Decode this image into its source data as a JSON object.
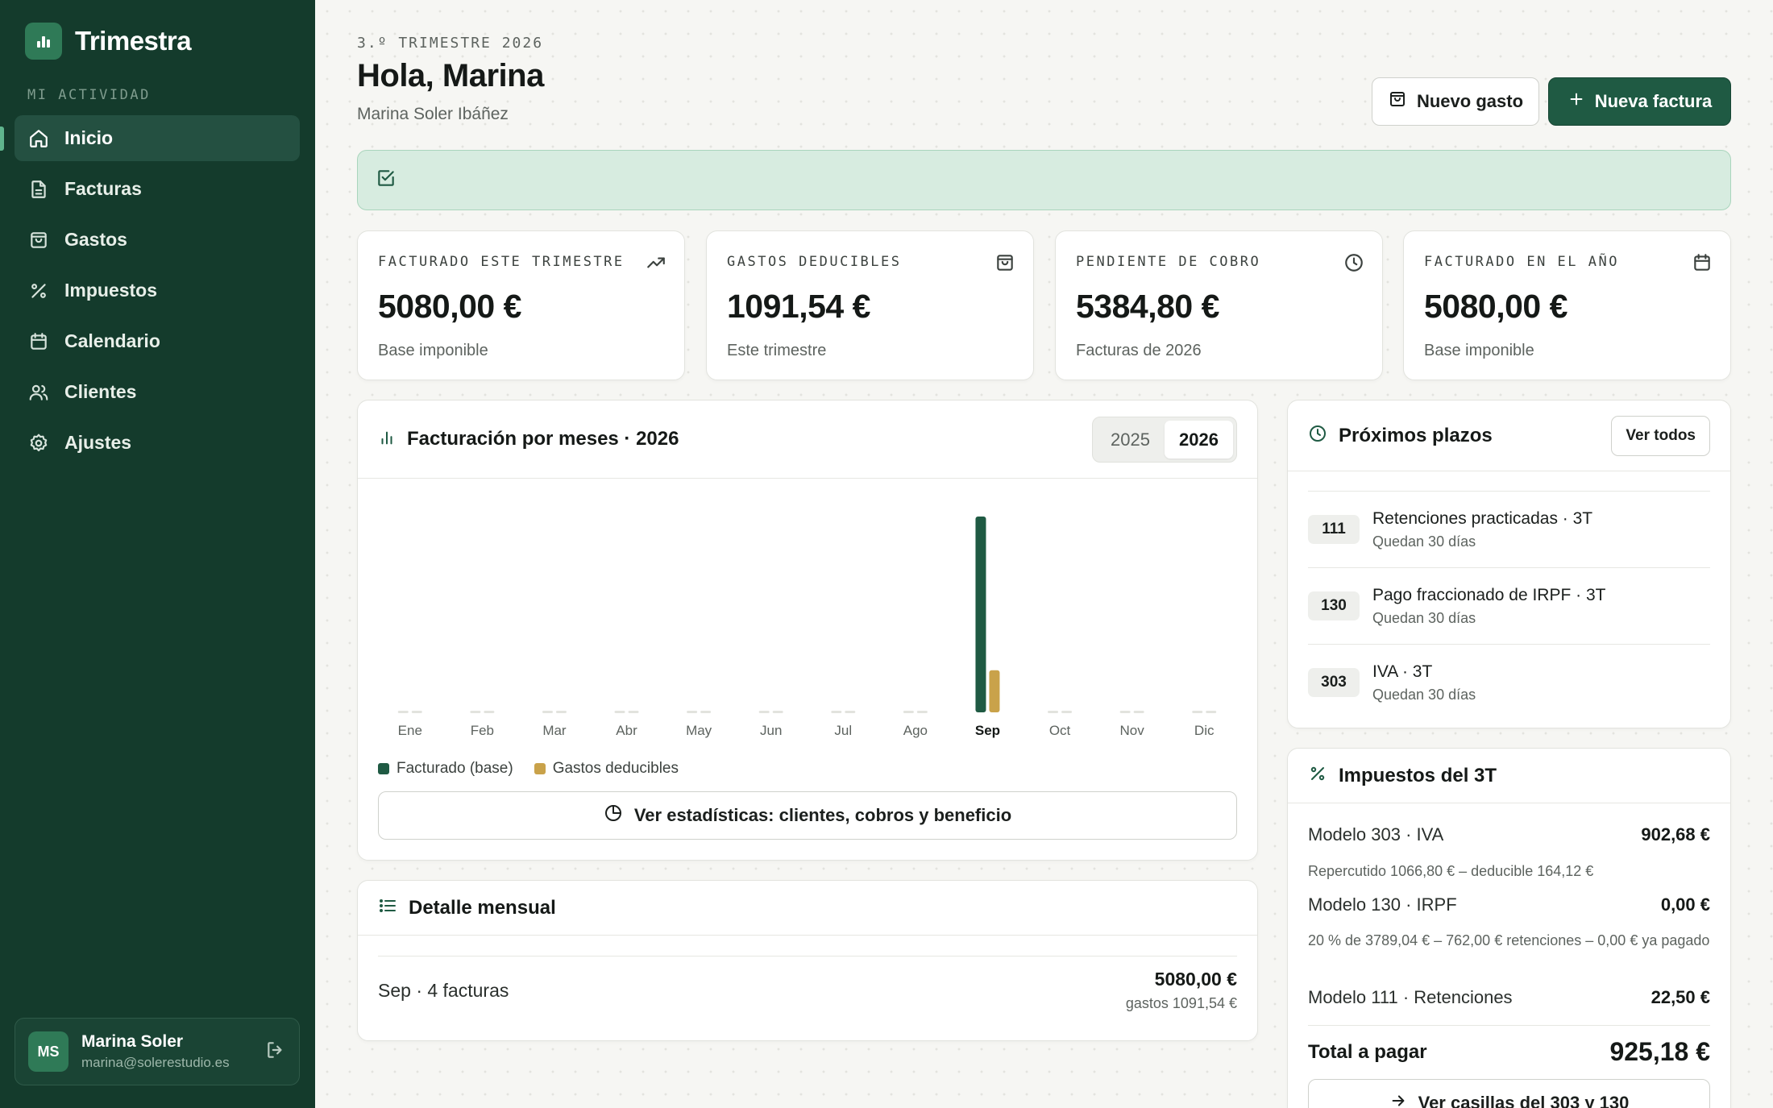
{
  "app": {
    "name": "Trimestra"
  },
  "sidebar": {
    "section_label": "MI ACTIVIDAD",
    "items": [
      {
        "label": "Inicio",
        "icon": "home-icon",
        "active": true
      },
      {
        "label": "Facturas",
        "icon": "document-icon"
      },
      {
        "label": "Gastos",
        "icon": "shopping-bag-icon"
      },
      {
        "label": "Impuestos",
        "icon": "percent-icon"
      },
      {
        "label": "Calendario",
        "icon": "calendar-icon"
      },
      {
        "label": "Clientes",
        "icon": "users-icon"
      },
      {
        "label": "Ajustes",
        "icon": "gear-icon"
      }
    ],
    "user": {
      "initials": "MS",
      "name": "Marina Soler",
      "email": "marina@solerestudio.es"
    }
  },
  "header": {
    "eyebrow": "3.º TRIMESTRE 2026",
    "greeting": "Hola, Marina",
    "fullname": "Marina Soler Ibáñez",
    "new_expense": "Nuevo gasto",
    "new_invoice": "Nueva factura"
  },
  "stats": [
    {
      "label": "FACTURADO ESTE TRIMESTRE",
      "value": "5080,00 €",
      "sub": "Base imponible",
      "icon": "trending-up-icon"
    },
    {
      "label": "GASTOS DEDUCIBLES",
      "value": "1091,54 €",
      "sub": "Este trimestre",
      "icon": "shopping-bag-icon"
    },
    {
      "label": "PENDIENTE DE COBRO",
      "value": "5384,80 €",
      "sub": "Facturas de 2026",
      "icon": "clock-icon"
    },
    {
      "label": "FACTURADO EN EL AÑO",
      "value": "5080,00 €",
      "sub": "Base imponible",
      "icon": "calendar-icon"
    }
  ],
  "chart_card": {
    "title": "Facturación por meses · 2026",
    "years": [
      "2025",
      "2026"
    ],
    "selected_year": "2026",
    "stats_button": "Ver estadísticas: clientes, cobros y beneficio"
  },
  "chart_data": {
    "type": "bar",
    "categories": [
      "Ene",
      "Feb",
      "Mar",
      "Abr",
      "May",
      "Jun",
      "Jul",
      "Ago",
      "Sep",
      "Oct",
      "Nov",
      "Dic"
    ],
    "highlight": "Sep",
    "series": [
      {
        "name": "Facturado (base)",
        "color": "#1f5a43",
        "values": [
          0,
          0,
          0,
          0,
          0,
          0,
          0,
          0,
          5080.0,
          0,
          0,
          0
        ]
      },
      {
        "name": "Gastos deducibles",
        "color": "#c9a24a",
        "values": [
          0,
          0,
          0,
          0,
          0,
          0,
          0,
          0,
          1091.54,
          0,
          0,
          0
        ]
      }
    ],
    "grid": false,
    "legend": "bottom-left"
  },
  "detail": {
    "title": "Detalle mensual",
    "row": {
      "label": "Sep · 4 facturas",
      "amount": "5080,00 €",
      "gastos": "gastos 1091,54 €"
    }
  },
  "plazos": {
    "title": "Próximos plazos",
    "view_all": "Ver todos",
    "items": [
      {
        "code": "111",
        "title": "Retenciones practicadas · 3T",
        "sub": "Quedan 30 días"
      },
      {
        "code": "130",
        "title": "Pago fraccionado de IRPF · 3T",
        "sub": "Quedan 30 días"
      },
      {
        "code": "303",
        "title": "IVA · 3T",
        "sub": "Quedan 30 días"
      }
    ]
  },
  "taxes": {
    "title": "Impuestos del 3T",
    "rows": [
      {
        "label": "Modelo 303 · IVA",
        "amount": "902,68 €",
        "note": "Repercutido 1066,80 € – deducible 164,12 €"
      },
      {
        "label": "Modelo 130 · IRPF",
        "amount": "0,00 €",
        "note": "20 % de 3789,04 € – 762,00 € retenciones – 0,00 € ya pagado"
      },
      {
        "label": "Modelo 111 · Retenciones",
        "amount": "22,50 €"
      }
    ],
    "total_label": "Total a pagar",
    "total_value": "925,18 €",
    "button": "Ver casillas del 303 y 130"
  }
}
